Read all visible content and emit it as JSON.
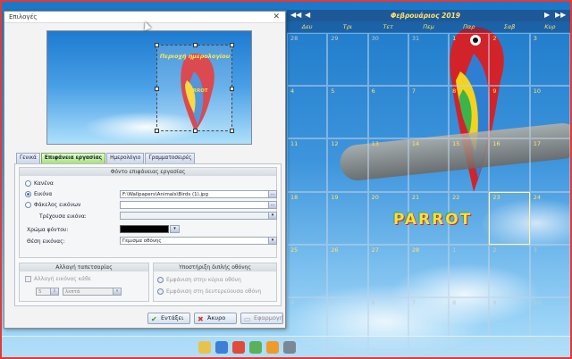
{
  "dialog": {
    "title": "Επιλογές",
    "close_glyph": "✕",
    "preview": {
      "selection_title": "Περιοχή ημερολογίου",
      "wallpaper_text": "PARROT"
    },
    "tabs": [
      {
        "label": "Γενικά"
      },
      {
        "label": "Επιφάνεια εργασίας"
      },
      {
        "label": "Ημερολόγιο"
      },
      {
        "label": "Γραμματοσειρές"
      }
    ],
    "background_group": {
      "title": "Φόντο επιφάνειας εργασίας",
      "option_none": "Κανένα",
      "option_image": "Εικόνα",
      "image_path": "F:\\Wallpapers\\Animals\\Birds (1).jpg",
      "option_folder": "Φάκελος εικόνων",
      "folder_path": "",
      "current_image_label": "Τρέχουσα εικόνα:",
      "current_image_value": "",
      "bg_color_label": "Χρώμα φόντου:",
      "bg_color": "#000000",
      "image_position_label": "Θέση εικόνας:",
      "image_position_value": "Γέμισμα οθόνης"
    },
    "wallpaper_change_group": {
      "title": "Αλλαγή ταπετσαρίας",
      "checkbox_label": "Αλλαγή εικόνας κάθε",
      "interval_value": "5",
      "interval_unit": "λεπτά"
    },
    "dual_screen_group": {
      "title": "Υποστήριξη διπλής οθόνης",
      "option_main": "Εμφάνιση στην κύρια οθόνη",
      "option_secondary": "Εμφάνιση στη δευτερεύουσα οθόνη"
    },
    "buttons": {
      "ok": "Εντάξει",
      "cancel": "Άκυρο",
      "apply": "Εφαρμογή"
    }
  },
  "calendar": {
    "title": "Φεβρουάριος 2019",
    "nav_prev_year": "◀◀",
    "nav_prev": "◀",
    "nav_next": "▶",
    "nav_next_year": "▶▶",
    "weekdays": [
      "Δευ",
      "Τρι",
      "Τετ",
      "Πεμ",
      "Παρ",
      "Σαβ",
      "Κυρ"
    ],
    "days": [
      {
        "d": "28",
        "muted": true
      },
      {
        "d": "29",
        "muted": true
      },
      {
        "d": "30",
        "muted": true
      },
      {
        "d": "31",
        "muted": true
      },
      {
        "d": "1"
      },
      {
        "d": "2"
      },
      {
        "d": "3"
      },
      {
        "d": "4"
      },
      {
        "d": "5"
      },
      {
        "d": "6"
      },
      {
        "d": "7"
      },
      {
        "d": "8"
      },
      {
        "d": "9"
      },
      {
        "d": "10"
      },
      {
        "d": "11"
      },
      {
        "d": "12"
      },
      {
        "d": "13"
      },
      {
        "d": "14"
      },
      {
        "d": "15"
      },
      {
        "d": "16"
      },
      {
        "d": "17"
      },
      {
        "d": "18"
      },
      {
        "d": "19"
      },
      {
        "d": "20"
      },
      {
        "d": "21"
      },
      {
        "d": "22"
      },
      {
        "d": "23",
        "today": true
      },
      {
        "d": "24"
      },
      {
        "d": "25"
      },
      {
        "d": "26"
      },
      {
        "d": "27"
      },
      {
        "d": "28"
      },
      {
        "d": "1",
        "muted": true
      },
      {
        "d": "2",
        "muted": true
      },
      {
        "d": "3",
        "muted": true
      },
      {
        "d": "4",
        "muted": true
      },
      {
        "d": "5",
        "muted": true
      },
      {
        "d": "6",
        "muted": true
      },
      {
        "d": "7",
        "muted": true
      },
      {
        "d": "8",
        "muted": true
      },
      {
        "d": "9",
        "muted": true
      },
      {
        "d": "10",
        "muted": true
      }
    ],
    "wallpaper_text": "PARROT"
  },
  "colors": {
    "calendar_text": "#ffe46a",
    "active_tab": "#a8e07a",
    "border_red": "#e23a36"
  }
}
